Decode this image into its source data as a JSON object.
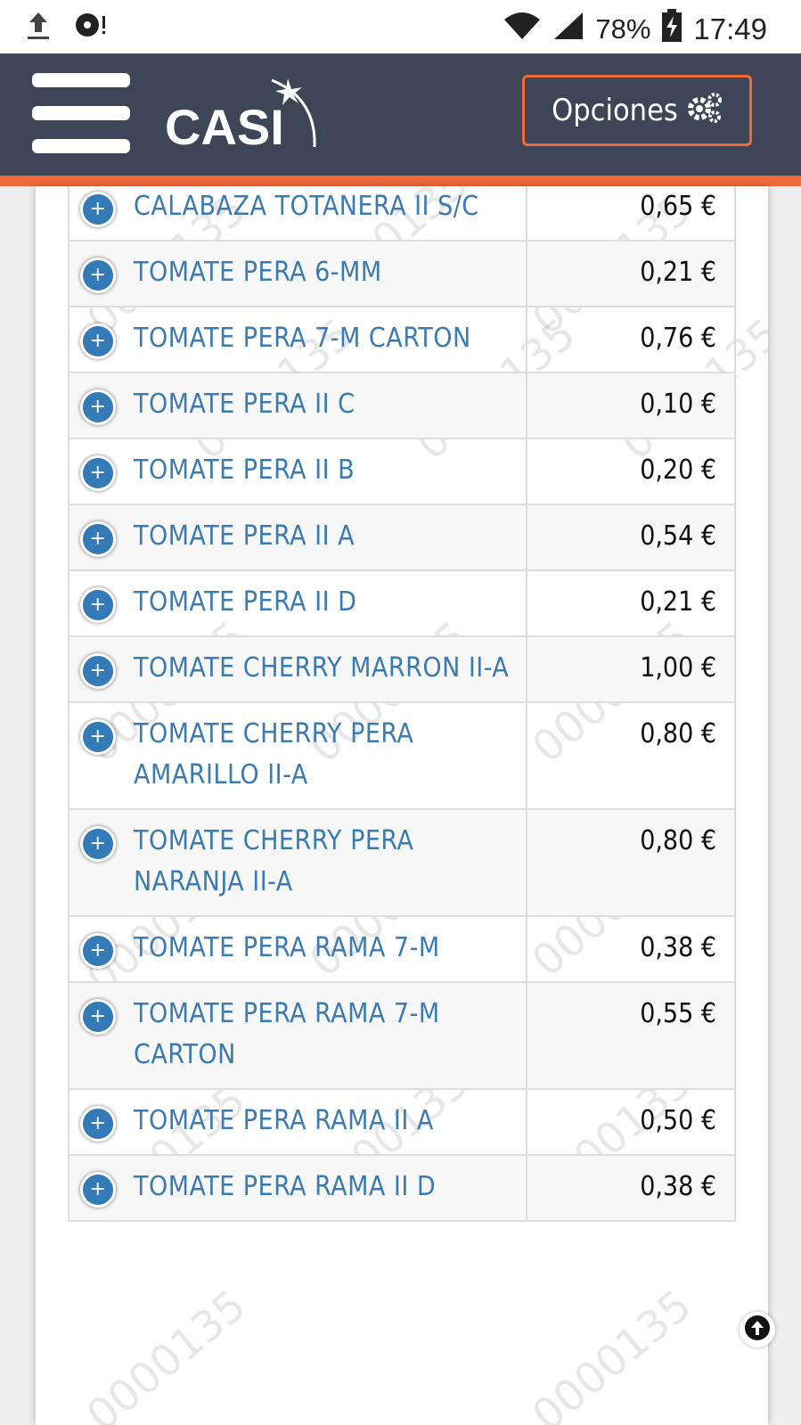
{
  "status_bar": {
    "icons_left": [
      "upload-icon",
      "disc-alert-icon"
    ],
    "battery_percent": "78%",
    "time": "17:49",
    "icons_right": [
      "wifi-icon",
      "signal-icon",
      "battery-charging-icon"
    ]
  },
  "header": {
    "logo_text": "CASI",
    "options_label": "Opciones",
    "options_icon": "gears-icon",
    "colors": {
      "bar": "#3d4556",
      "accent": "#f06a3a"
    }
  },
  "watermark_text": "0000135",
  "products": [
    {
      "name": "CALABAZA TOTANERA II S/C",
      "price": "0,65 €"
    },
    {
      "name": "TOMATE PERA 6-MM",
      "price": "0,21 €"
    },
    {
      "name": "TOMATE PERA 7-M CARTON",
      "price": "0,76 €"
    },
    {
      "name": "TOMATE PERA II C",
      "price": "0,10 €"
    },
    {
      "name": "TOMATE PERA II B",
      "price": "0,20 €"
    },
    {
      "name": "TOMATE PERA II A",
      "price": "0,54 €"
    },
    {
      "name": "TOMATE PERA II D",
      "price": "0,21 €"
    },
    {
      "name": "TOMATE CHERRY MARRON II-A",
      "price": "1,00 €"
    },
    {
      "name": "TOMATE CHERRY PERA AMARILLO II-A",
      "price": "0,80 €"
    },
    {
      "name": "TOMATE CHERRY PERA NARANJA II-A",
      "price": "0,80 €"
    },
    {
      "name": "TOMATE PERA RAMA 7-M",
      "price": "0,38 €"
    },
    {
      "name": "TOMATE PERA RAMA 7-M CARTON",
      "price": "0,55 €"
    },
    {
      "name": "TOMATE PERA RAMA II A",
      "price": "0,50 €"
    },
    {
      "name": "TOMATE PERA RAMA II D",
      "price": "0,38 €"
    }
  ]
}
